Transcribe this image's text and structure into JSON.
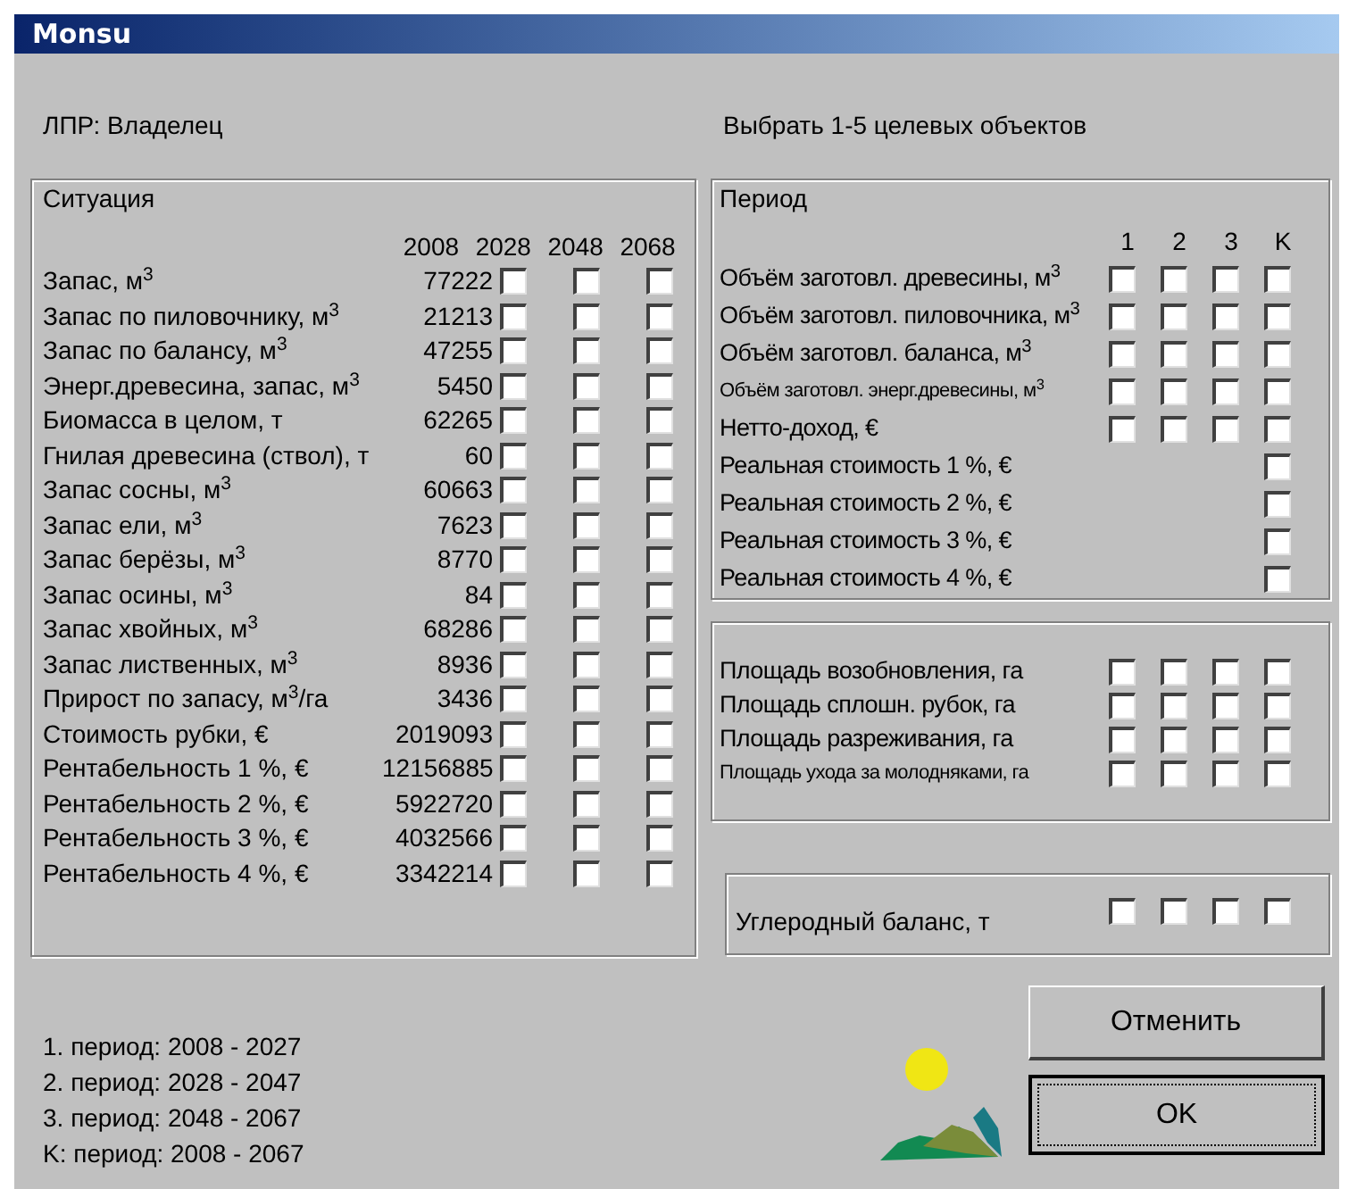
{
  "window": {
    "title": "Monsu"
  },
  "decision_maker": "ЛПР: Владелец",
  "instruction": "Выбрать 1-5 целевых объектов",
  "situation": {
    "title": "Ситуация",
    "columns": [
      "2008",
      "2028",
      "2048",
      "2068"
    ],
    "rows": [
      {
        "label": "Запас, м$^{3}$",
        "value": "77222",
        "checked": [
          false,
          false,
          false
        ]
      },
      {
        "label": "Запас по пиловочнику, м$^{3}$",
        "value": "21213",
        "checked": [
          false,
          false,
          false
        ]
      },
      {
        "label": "Запас по балансу, м$^{3}$",
        "value": "47255",
        "checked": [
          false,
          false,
          false
        ]
      },
      {
        "label": "Энерг.древесина, запас, м$^{3}$",
        "value": "5450",
        "checked": [
          false,
          false,
          false
        ]
      },
      {
        "label": "Биомасса в целом, т",
        "value": "62265",
        "checked": [
          false,
          false,
          false
        ]
      },
      {
        "label": "Гнилая древесина (ствол), т",
        "value": "60",
        "checked": [
          false,
          false,
          false
        ]
      },
      {
        "label": "Запас сосны, м$^{3}$",
        "value": "60663",
        "checked": [
          false,
          false,
          false
        ]
      },
      {
        "label": "Запас ели, м$^{3}$",
        "value": "7623",
        "checked": [
          false,
          false,
          false
        ]
      },
      {
        "label": "Запас берёзы, м$^{3}$",
        "value": "8770",
        "checked": [
          false,
          false,
          false
        ]
      },
      {
        "label": "Запас осины, м$^{3}$",
        "value": "84",
        "checked": [
          false,
          false,
          false
        ]
      },
      {
        "label": "Запас хвойных, м$^{3}$",
        "value": "68286",
        "checked": [
          false,
          false,
          false
        ]
      },
      {
        "label": "Запас лиственных, м$^{3}$",
        "value": "8936",
        "checked": [
          false,
          false,
          false
        ]
      },
      {
        "label": "Прирост по запасу, м$^{3}$/га",
        "value": "3436",
        "checked": [
          false,
          false,
          false
        ]
      },
      {
        "label": "Стоимость рубки, €",
        "value": "2019093",
        "checked": [
          false,
          false,
          false
        ]
      },
      {
        "label": "Рентабельность 1 %, €",
        "value": "12156885",
        "checked": [
          false,
          false,
          false
        ]
      },
      {
        "label": "Рентабельность 2 %, €",
        "value": "5922720",
        "checked": [
          false,
          false,
          false
        ]
      },
      {
        "label": "Рентабельность 3 %, €",
        "value": "4032566",
        "checked": [
          false,
          false,
          false
        ]
      },
      {
        "label": "Рентабельность 4 %, €",
        "value": "3342214",
        "checked": [
          false,
          false,
          false
        ]
      }
    ]
  },
  "period": {
    "title": "Период",
    "columns": [
      "1",
      "2",
      "3",
      "K"
    ],
    "rows": [
      {
        "label": "Объём заготовл. древесины, м$^{3}$",
        "kind": "normal",
        "checked": [
          false,
          false,
          false,
          false
        ]
      },
      {
        "label": "Объём заготовл. пиловочника, м$^{3}$",
        "kind": "normal",
        "checked": [
          false,
          false,
          false,
          false
        ]
      },
      {
        "label": "Объём заготовл. баланса, м$^{3}$",
        "kind": "normal",
        "checked": [
          false,
          false,
          false,
          false
        ]
      },
      {
        "label": "Объём заготовл. энерг.древесины, м$^{3}$",
        "kind": "compact",
        "checked": [
          false,
          false,
          false,
          false
        ]
      },
      {
        "label": "Нетто-доход, €",
        "kind": "normal",
        "checked": [
          false,
          false,
          false,
          false
        ]
      },
      {
        "label": "Реальная стоимость 1 %, €",
        "kind": "normal",
        "checked": [
          false
        ]
      },
      {
        "label": "Реальная стоимость 2 %, €",
        "kind": "normal",
        "checked": [
          false
        ]
      },
      {
        "label": "Реальная стоимость 3 %, €",
        "kind": "normal",
        "checked": [
          false
        ]
      },
      {
        "label": "Реальная стоимость 4 %, €",
        "kind": "normal",
        "checked": [
          false
        ]
      }
    ]
  },
  "areas": {
    "rows": [
      {
        "label": "Площадь возобновления, га",
        "kind": "normal",
        "checked": [
          false,
          false,
          false,
          false
        ]
      },
      {
        "label": "Площадь сплошн. рубок, га",
        "kind": "normal",
        "checked": [
          false,
          false,
          false,
          false
        ]
      },
      {
        "label": "Площадь разреживания, га",
        "kind": "normal",
        "checked": [
          false,
          false,
          false,
          false
        ]
      },
      {
        "label": "Площадь ухода за молодняками, га",
        "kind": "compact",
        "checked": [
          false,
          false,
          false,
          false
        ]
      }
    ]
  },
  "carbon": {
    "label": "Углеродный баланс, т",
    "checked": [
      false,
      false,
      false,
      false
    ]
  },
  "legend": [
    "1. период: 2008 - 2027",
    "2. период: 2028 - 2047",
    "3. период: 2048 - 2067",
    "K: период: 2008 - 2067"
  ],
  "buttons": [
    {
      "label": "Отменить",
      "default": false
    },
    {
      "label": "OK",
      "default": true
    }
  ]
}
